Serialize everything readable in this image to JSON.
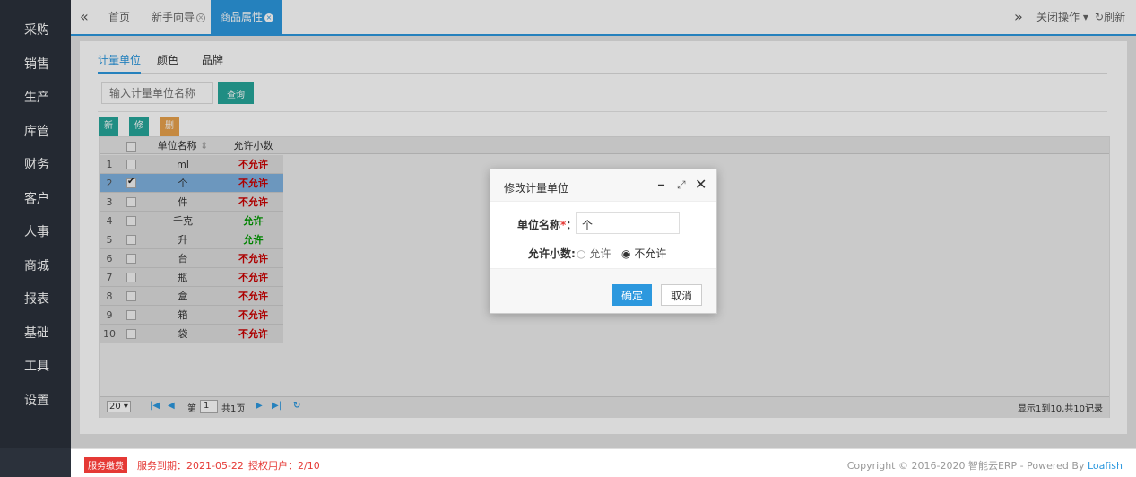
{
  "sidebar": {
    "items": [
      "采购",
      "销售",
      "生产",
      "库管",
      "财务",
      "客户",
      "人事",
      "商城",
      "报表",
      "基础",
      "工具",
      "设置"
    ]
  },
  "tabs": {
    "home": "首页",
    "guide": "新手向导",
    "attr": "商品属性",
    "close_ops": "关闭操作",
    "refresh": "刷新"
  },
  "subtabs": [
    "计量单位",
    "颜色",
    "品牌"
  ],
  "search": {
    "placeholder": "输入计量单位名称",
    "button": "查询"
  },
  "toolbar": {
    "add": "新增",
    "edit": "修改",
    "delete": "删除"
  },
  "grid": {
    "headers": {
      "name": "单位名称",
      "decimal": "允许小数"
    },
    "rows": [
      {
        "no": "1",
        "name": "ml",
        "decimal": "不允许",
        "checked": false
      },
      {
        "no": "2",
        "name": "个",
        "decimal": "不允许",
        "checked": true
      },
      {
        "no": "3",
        "name": "件",
        "decimal": "不允许",
        "checked": false
      },
      {
        "no": "4",
        "name": "千克",
        "decimal": "允许",
        "checked": false
      },
      {
        "no": "5",
        "name": "升",
        "decimal": "允许",
        "checked": false
      },
      {
        "no": "6",
        "name": "台",
        "decimal": "不允许",
        "checked": false
      },
      {
        "no": "7",
        "name": "瓶",
        "decimal": "不允许",
        "checked": false
      },
      {
        "no": "8",
        "name": "盒",
        "decimal": "不允许",
        "checked": false
      },
      {
        "no": "9",
        "name": "箱",
        "decimal": "不允许",
        "checked": false
      },
      {
        "no": "10",
        "name": "袋",
        "decimal": "不允许",
        "checked": false
      }
    ]
  },
  "pager": {
    "page_size": "20",
    "page_prefix": "第",
    "page": "1",
    "page_total": "共1页",
    "summary": "显示1到10,共10记录"
  },
  "modal": {
    "title": "修改计量单位",
    "name_label": "单位名称",
    "name_required": "*",
    "name_colon": "：",
    "name_value": "个",
    "decimal_label": "允许小数:",
    "opt_allow": "允许",
    "opt_deny": "不允许",
    "selected": "不允许",
    "ok": "确定",
    "cancel": "取消"
  },
  "footer": {
    "badge": "服务缴费",
    "expiry": "服务到期：2021-05-22",
    "users": "授权用户：2/10",
    "copyright": "Copyright © 2016-2020 智能云ERP - Powered By ",
    "brand": "Loafish"
  },
  "colors": {
    "accent": "#2c98de",
    "teal": "#26a69a",
    "orange": "#e8a24c",
    "sidebar": "#2b313b",
    "danger": "#e53935"
  }
}
